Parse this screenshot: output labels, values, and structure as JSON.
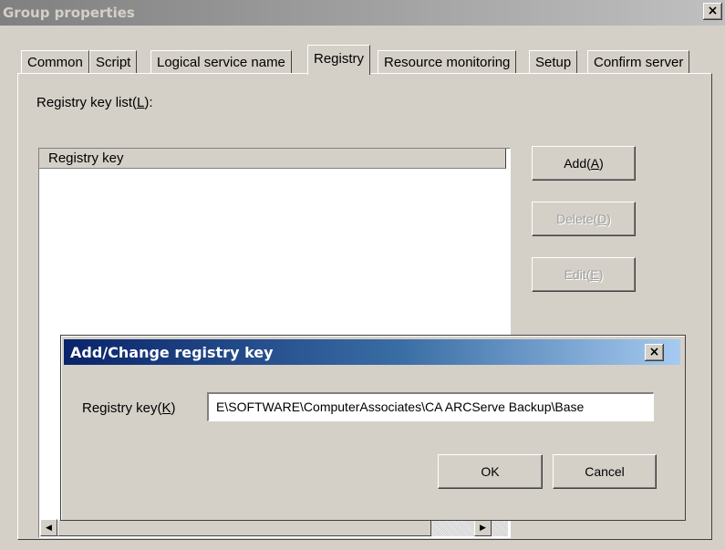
{
  "window": {
    "title": "Group properties",
    "close_glyph": "×"
  },
  "tabs": [
    {
      "label": "Common"
    },
    {
      "label": "Script"
    },
    {
      "label": "Logical service name"
    },
    {
      "label": "Registry"
    },
    {
      "label": "Resource monitoring"
    },
    {
      "label": "Setup"
    },
    {
      "label": "Confirm server"
    }
  ],
  "active_tab": "Registry",
  "registry": {
    "list_label": {
      "text": "Registry key list(",
      "accel": "L",
      "suffix": "):"
    },
    "column_header": "Registry key",
    "items": [],
    "buttons": {
      "add": {
        "text": "Add(",
        "accel": "A",
        "suffix": ")",
        "enabled": true
      },
      "delete": {
        "text": "Delete(",
        "accel": "D",
        "suffix": ")",
        "enabled": false
      },
      "edit": {
        "text": "Edit(",
        "accel": "E",
        "suffix": ")",
        "enabled": false
      }
    }
  },
  "dialog": {
    "title": "Add/Change registry key",
    "close_glyph": "×",
    "field_label": {
      "text": "Registry key(",
      "accel": "K",
      "suffix": ")"
    },
    "field_value": "E\\SOFTWARE\\ComputerAssociates\\CA ARCServe Backup\\Base",
    "ok_label": "OK",
    "cancel_label": "Cancel"
  },
  "scrollbar": {
    "left_arrow": "◀",
    "right_arrow": "▶"
  }
}
